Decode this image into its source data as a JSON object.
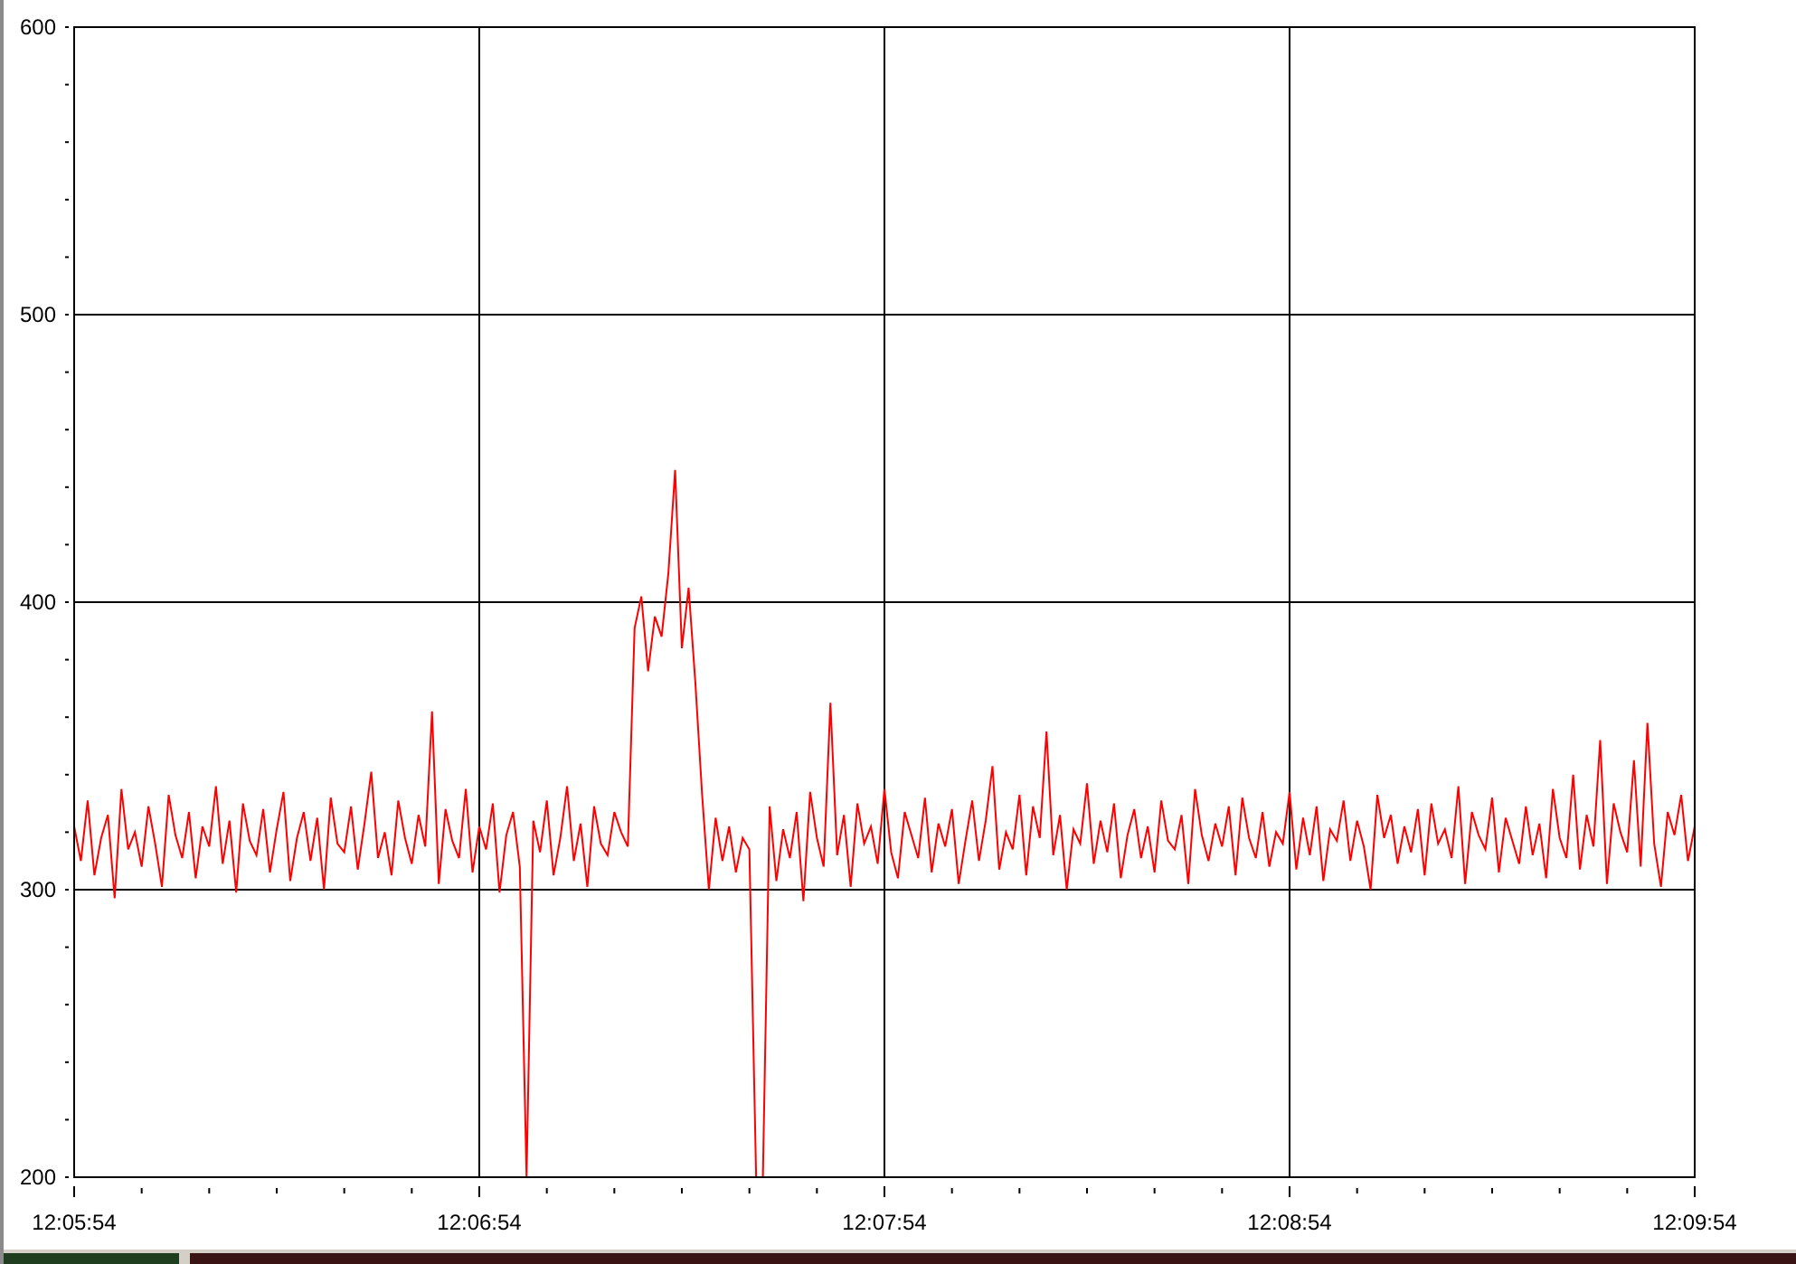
{
  "chart_data": {
    "type": "line",
    "grid": true,
    "ylim": [
      200,
      600
    ],
    "yticks": [
      200,
      300,
      400,
      500,
      600
    ],
    "categories": [
      "12:05:54",
      null,
      null,
      null,
      null,
      null,
      null,
      null,
      null,
      null,
      null,
      null,
      null,
      null,
      null,
      null,
      null,
      null,
      null,
      null,
      null,
      null,
      null,
      null,
      null,
      null,
      null,
      null,
      null,
      null,
      null,
      null,
      null,
      null,
      null,
      null,
      null,
      null,
      null,
      null,
      null,
      null,
      null,
      null,
      null,
      null,
      null,
      null,
      null,
      null,
      null,
      null,
      null,
      null,
      null,
      null,
      null,
      null,
      null,
      null,
      "12:06:54",
      null,
      null,
      null,
      null,
      null,
      null,
      null,
      null,
      null,
      null,
      null,
      null,
      null,
      null,
      null,
      null,
      null,
      null,
      null,
      null,
      null,
      null,
      null,
      null,
      null,
      null,
      null,
      null,
      null,
      null,
      null,
      null,
      null,
      null,
      null,
      null,
      null,
      null,
      null,
      null,
      null,
      null,
      null,
      null,
      null,
      null,
      null,
      null,
      null,
      null,
      null,
      null,
      null,
      null,
      null,
      null,
      null,
      null,
      null,
      "12:07:54",
      null,
      null,
      null,
      null,
      null,
      null,
      null,
      null,
      null,
      null,
      null,
      null,
      null,
      null,
      null,
      null,
      null,
      null,
      null,
      null,
      null,
      null,
      null,
      null,
      null,
      null,
      null,
      null,
      null,
      null,
      null,
      null,
      null,
      null,
      null,
      null,
      null,
      null,
      null,
      null,
      null,
      null,
      null,
      null,
      null,
      null,
      null,
      null,
      null,
      null,
      null,
      null,
      null,
      null,
      null,
      null,
      null,
      null,
      null,
      "12:08:54",
      null,
      null,
      null,
      null,
      null,
      null,
      null,
      null,
      null,
      null,
      null,
      null,
      null,
      null,
      null,
      null,
      null,
      null,
      null,
      null,
      null,
      null,
      null,
      null,
      null,
      null,
      null,
      null,
      null,
      null,
      null,
      null,
      null,
      null,
      null,
      null,
      null,
      null,
      null,
      null,
      null,
      null,
      null,
      null,
      null,
      null,
      null,
      null,
      null,
      null,
      null,
      null,
      null,
      null,
      null,
      null,
      null,
      null,
      null,
      "12:09:54"
    ],
    "series": [
      {
        "color": "#ff0000",
        "values": [
          322,
          310,
          331,
          305,
          318,
          326,
          297,
          335,
          314,
          320,
          308,
          329,
          316,
          301,
          333,
          319,
          311,
          327,
          304,
          322,
          315,
          336,
          309,
          324,
          299,
          330,
          317,
          312,
          328,
          306,
          321,
          334,
          303,
          318,
          327,
          310,
          325,
          300,
          332,
          316,
          313,
          329,
          307,
          323,
          341,
          311,
          320,
          305,
          331,
          318,
          309,
          326,
          315,
          362,
          302,
          328,
          317,
          311,
          335,
          306,
          322,
          314,
          330,
          299,
          319,
          327,
          308,
          200,
          324,
          313,
          331,
          305,
          318,
          336,
          310,
          323,
          301,
          329,
          316,
          312,
          327,
          320,
          315,
          391,
          402,
          376,
          395,
          388,
          410,
          446,
          384,
          405,
          372,
          333,
          300,
          325,
          310,
          322,
          306,
          318,
          314,
          200,
          200,
          329,
          303,
          321,
          311,
          327,
          296,
          334,
          318,
          308,
          365,
          312,
          326,
          301,
          330,
          316,
          322,
          309,
          335,
          313,
          304,
          327,
          319,
          311,
          332,
          306,
          323,
          315,
          328,
          302,
          317,
          331,
          310,
          324,
          343,
          307,
          320,
          314,
          333,
          305,
          329,
          318,
          355,
          312,
          326,
          300,
          321,
          316,
          337,
          309,
          324,
          313,
          330,
          304,
          319,
          328,
          311,
          322,
          306,
          331,
          317,
          314,
          326,
          302,
          335,
          319,
          310,
          323,
          315,
          329,
          305,
          332,
          318,
          311,
          327,
          308,
          320,
          316,
          334,
          307,
          325,
          312,
          329,
          303,
          321,
          317,
          331,
          310,
          324,
          315,
          300,
          333,
          318,
          326,
          309,
          322,
          313,
          328,
          305,
          330,
          316,
          321,
          311,
          336,
          302,
          327,
          319,
          314,
          332,
          306,
          325,
          317,
          309,
          329,
          312,
          323,
          304,
          335,
          318,
          311,
          340,
          307,
          326,
          315,
          352,
          302,
          330,
          320,
          313,
          345,
          308,
          358,
          316,
          301,
          327,
          319,
          333,
          310,
          322
        ]
      }
    ]
  }
}
